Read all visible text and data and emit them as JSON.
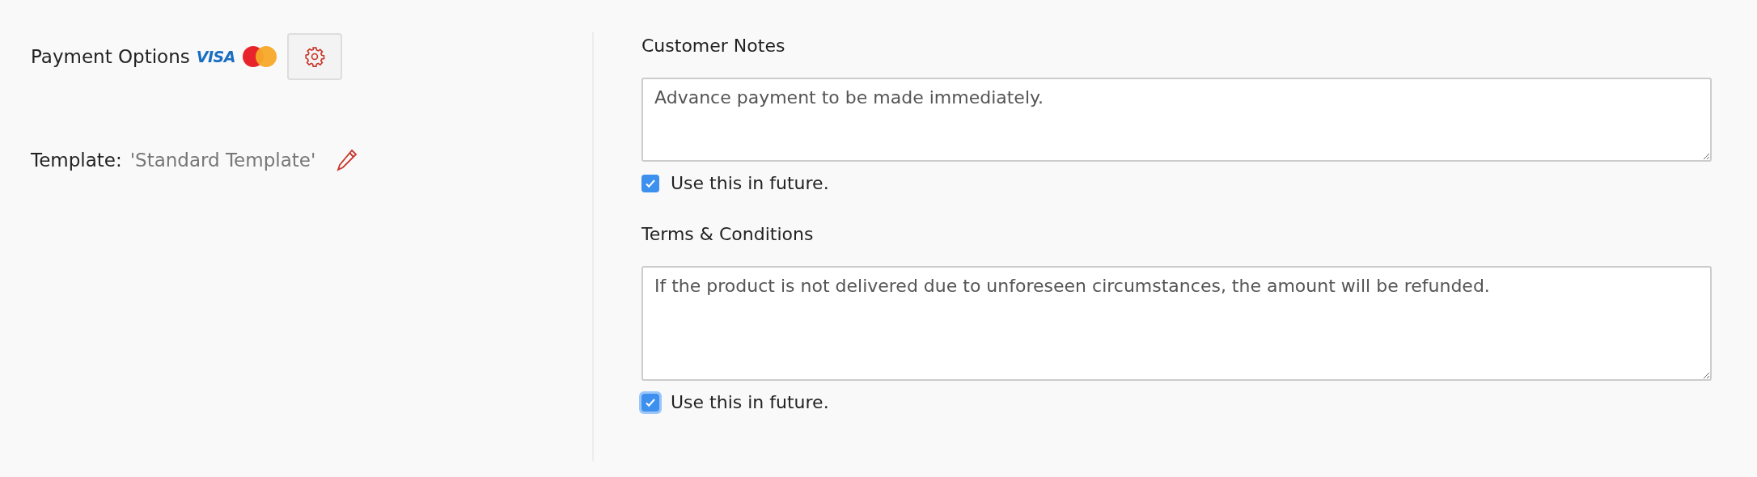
{
  "payment_options": {
    "label": "Payment Options",
    "card_label": "VISA"
  },
  "template": {
    "label": "Template:",
    "value": "'Standard Template'"
  },
  "sections": [
    {
      "title": "Customer Notes",
      "value": "Advance payment to be made immediately.",
      "checkbox": {
        "label": "Use this in future.",
        "checked": true,
        "focused": false
      }
    },
    {
      "title": "Terms & Conditions",
      "value": "If the product is not delivered due to unforeseen circumstances, the amount will be refunded.",
      "checkbox": {
        "label": "Use this in future.",
        "checked": true,
        "focused": true
      }
    }
  ]
}
